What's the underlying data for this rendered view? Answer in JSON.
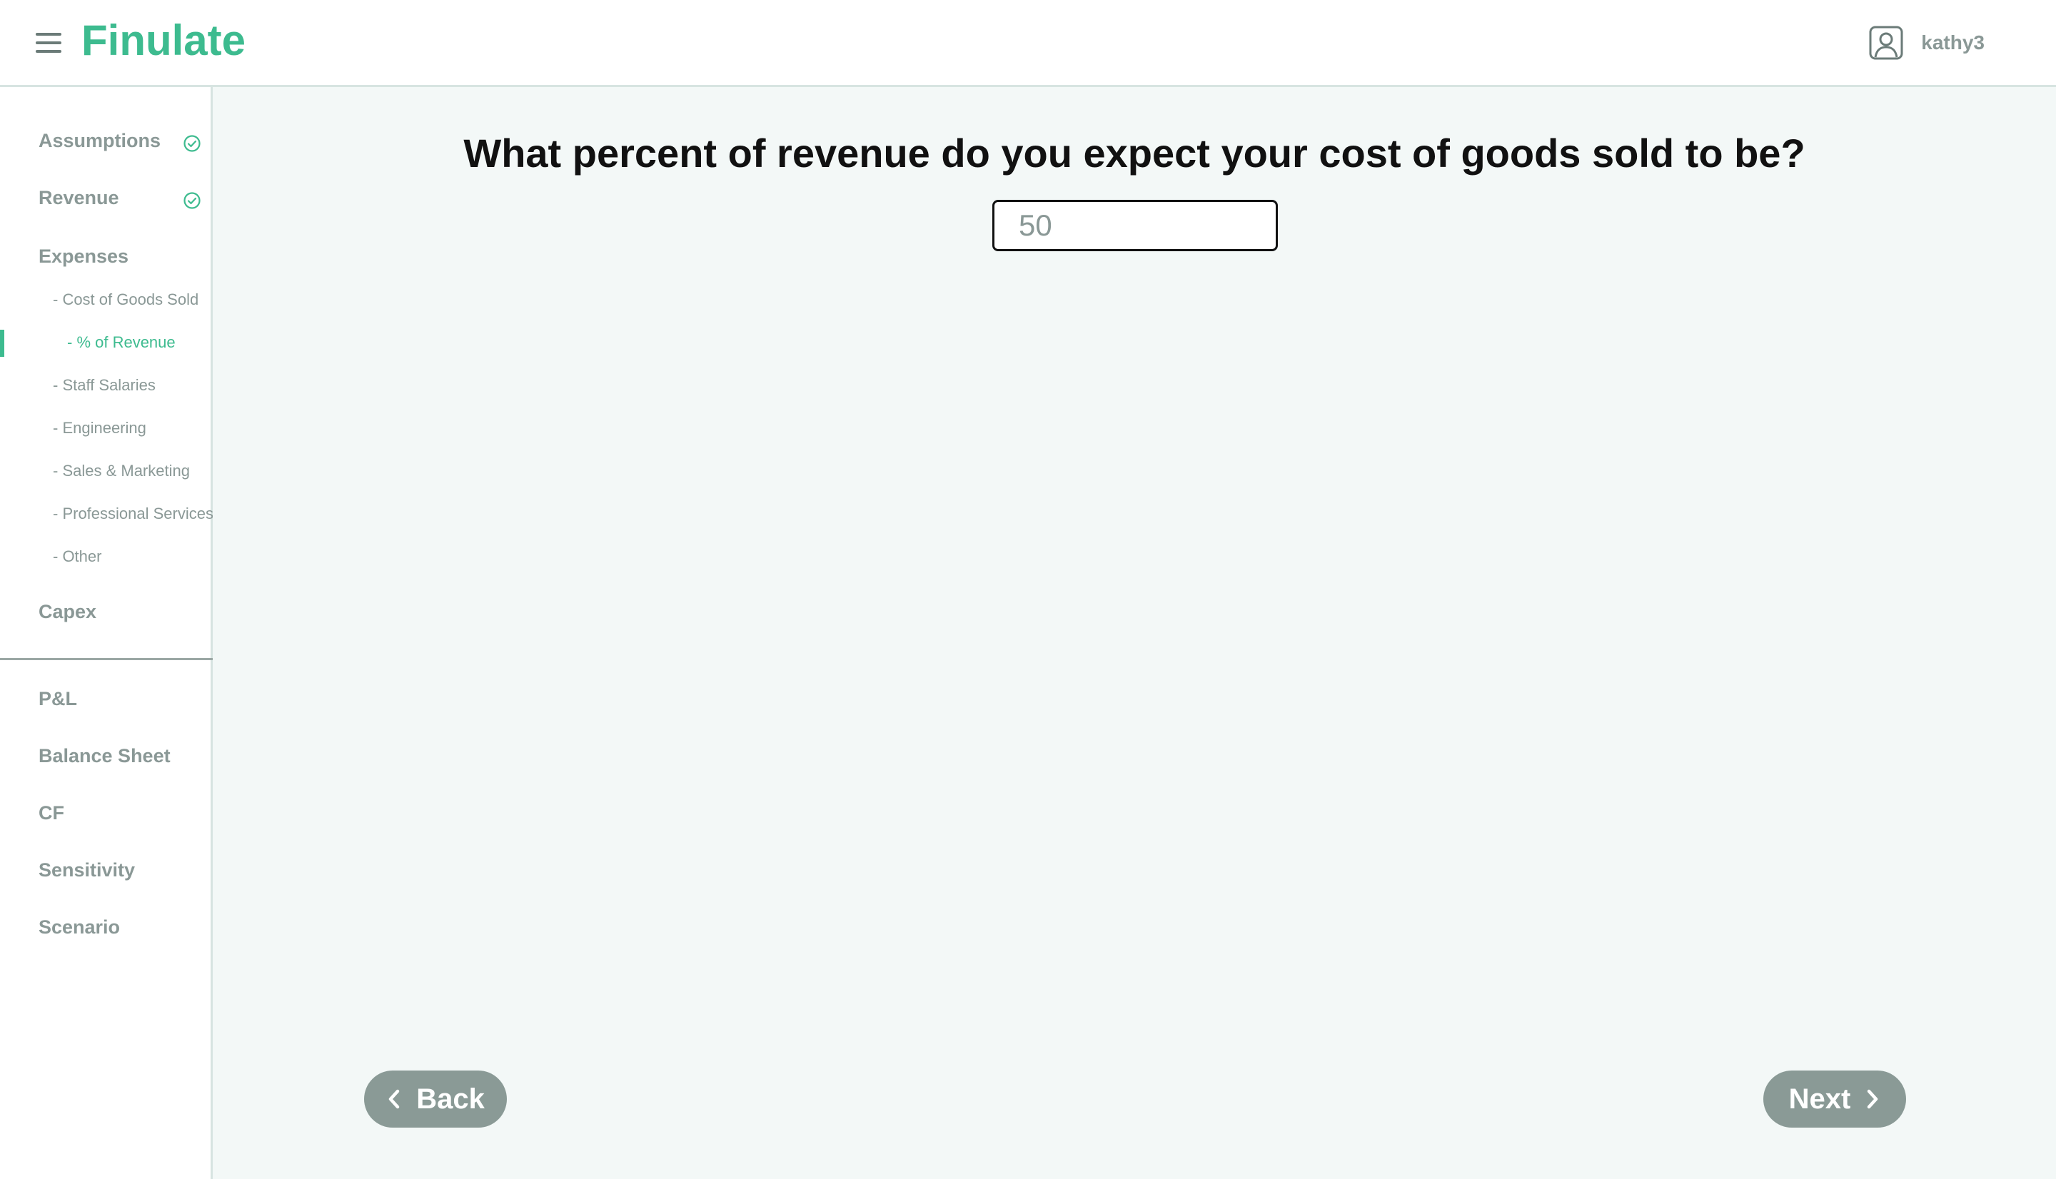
{
  "header": {
    "logo": "Finulate",
    "username": "kathy3"
  },
  "sidebar": {
    "items": [
      {
        "label": "Assumptions",
        "completed": true
      },
      {
        "label": "Revenue",
        "completed": true
      },
      {
        "label": "Expenses",
        "completed": false
      },
      {
        "label": "Capex",
        "completed": false
      }
    ],
    "expense_subitems": [
      "- Cost of Goods Sold",
      "- Staff Salaries",
      "- Engineering",
      "- Sales & Marketing",
      "- Professional Services",
      "- Other"
    ],
    "active_subsubitem": "- % of Revenue",
    "reports": [
      "P&L",
      "Balance Sheet",
      "CF",
      "Sensitivity",
      "Scenario"
    ]
  },
  "main": {
    "question": "What percent of revenue do you expect your cost of goods sold to be?",
    "input_placeholder": "50",
    "back_label": "Back",
    "next_label": "Next"
  },
  "colors": {
    "accent": "#3dbb8f",
    "muted_text": "#8a9896",
    "content_bg": "#f3f8f7",
    "button_bg": "#8a9a96"
  }
}
